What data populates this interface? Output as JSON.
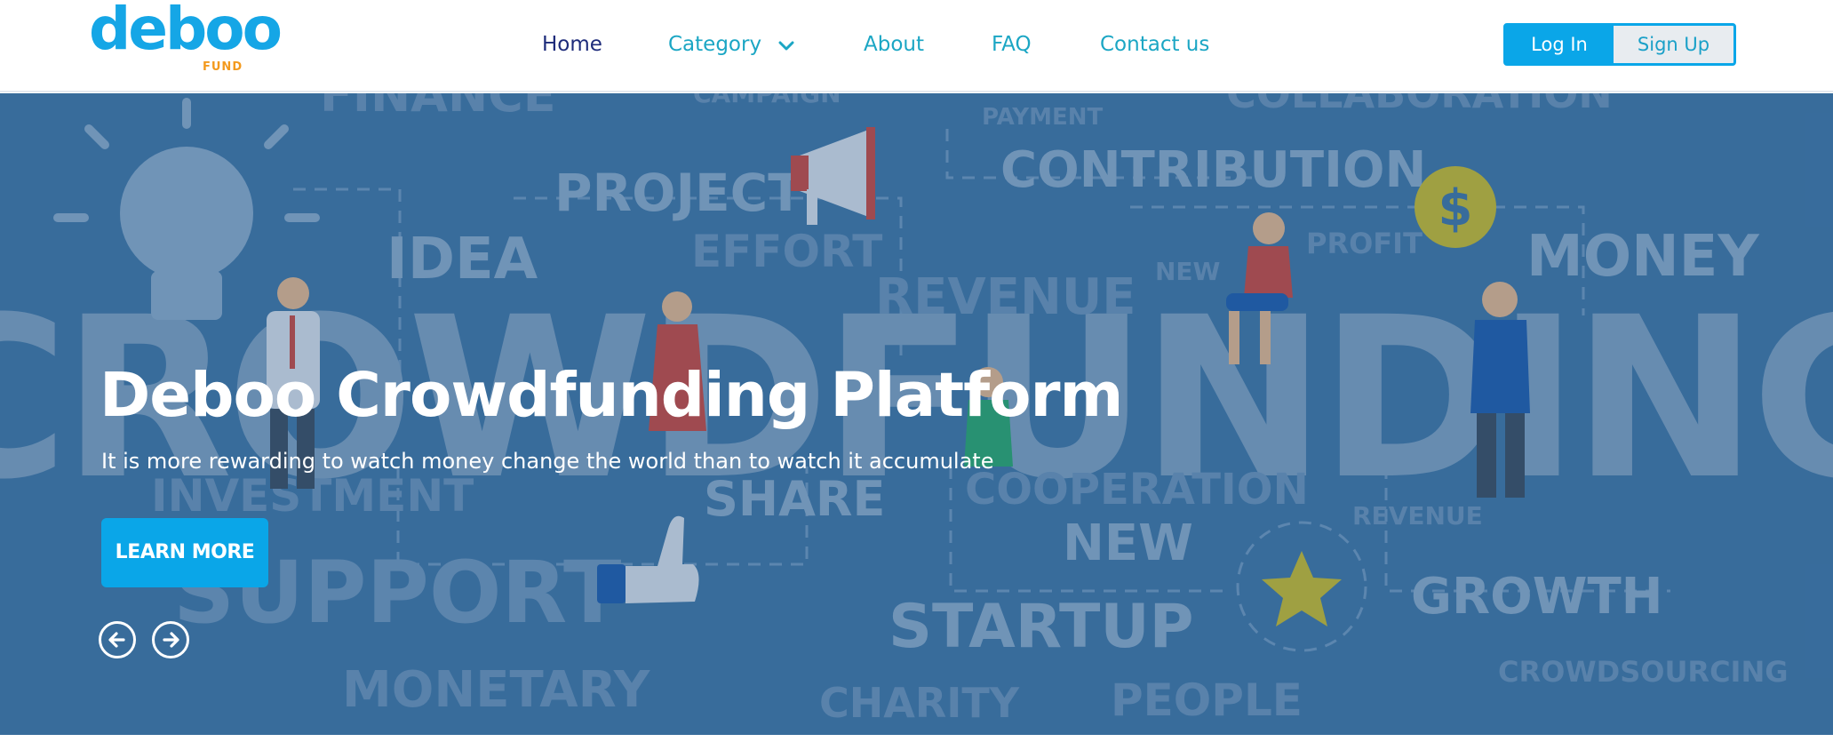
{
  "brand": {
    "logo_text": "deboo",
    "logo_sub": "FUND",
    "primary_color": "#0aa6e8",
    "accent_color": "#f39a1e"
  },
  "nav": {
    "items": [
      {
        "label": "Home",
        "active": true
      },
      {
        "label": "Category",
        "has_dropdown": true
      },
      {
        "label": "About"
      },
      {
        "label": "FAQ"
      },
      {
        "label": "Contact us"
      }
    ]
  },
  "auth": {
    "login_label": "Log In",
    "signup_label": "Sign Up"
  },
  "hero": {
    "title": "Deboo Crowdfunding Platform",
    "subtitle": "It is more rewarding to watch money change the world than to watch it accumulate",
    "cta_label": "LEARN MORE",
    "prev_icon": "arrow-left-circle-icon",
    "next_icon": "arrow-right-circle-icon",
    "background_color": "#3f73a1",
    "art_words": {
      "crowdfunding": "CROWDFUNDING",
      "finance": "FINANCE",
      "campaign": "CAMPAIGN",
      "collaboration": "COLLABORATION",
      "payment": "PAYMENT",
      "contribution": "CONTRIBUTION",
      "project": "PROJECT",
      "effort": "EFFORT",
      "idea": "IDEA",
      "profit": "PROFIT",
      "money": "MONEY",
      "new_small": "NEW",
      "revenue": "REVENUE",
      "investment": "INVESTMENT",
      "share": "SHARE",
      "cooperation": "COOPERATION",
      "revenue_small": "REVENUE",
      "new": "NEW",
      "support": "SUPPORT",
      "startup": "STARTUP",
      "growth": "GROWTH",
      "crowdsourcing": "CROWDSOURCING",
      "monetary": "MONETARY",
      "charity": "CHARITY",
      "people": "PEOPLE",
      "dollar": "$"
    }
  }
}
